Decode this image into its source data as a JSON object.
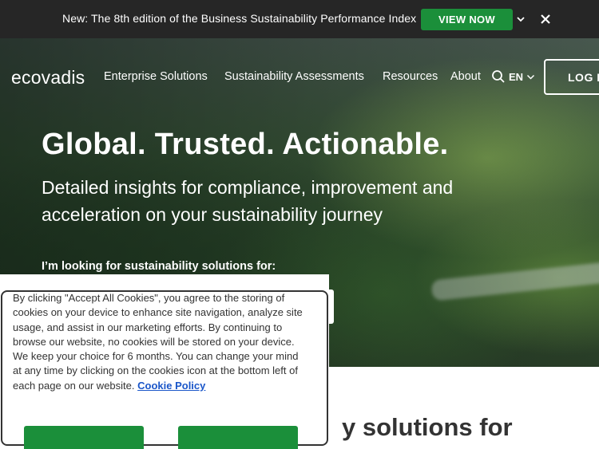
{
  "announcement": {
    "text": "New: The 8th edition of the Business Sustainability Performance Index",
    "cta_label": "VIEW NOW",
    "chevron_icon": "chevron-down-icon",
    "close_icon": "close-icon"
  },
  "nav": {
    "logo": "ecovadis",
    "items": [
      {
        "label": "Enterprise Solutions"
      },
      {
        "label": "Sustainability Assessments"
      },
      {
        "label": "Resources"
      },
      {
        "label": "About"
      }
    ],
    "search_icon": "search-icon",
    "language": "EN",
    "login_label": "LOG IN"
  },
  "hero": {
    "title": "Global. Trusted. Actionable.",
    "subtitle": "Detailed insights for compliance, improvement and acceleration on your sustainability journey",
    "selector_label": "I’m looking for sustainability solutions for:"
  },
  "section": {
    "heading_fragment": "y solutions for"
  },
  "cookie_banner": {
    "text_1": "By clicking \"Accept All Cookies\", you agree to the storing of cookies on your device to enhance site navigation, analyze site usage, and assist in our marketing efforts. By continuing to browse our website, no cookies will be stored on your device.",
    "text_2": "We keep your choice for 6 months. You can change your mind at any time by clicking on the cookies icon at the bottom left of each page on our website.",
    "policy_link": "Cookie Policy"
  },
  "colors": {
    "accent_green": "#1b8f3a",
    "announcement_bg": "#262626",
    "link_blue": "#1a56c9"
  }
}
